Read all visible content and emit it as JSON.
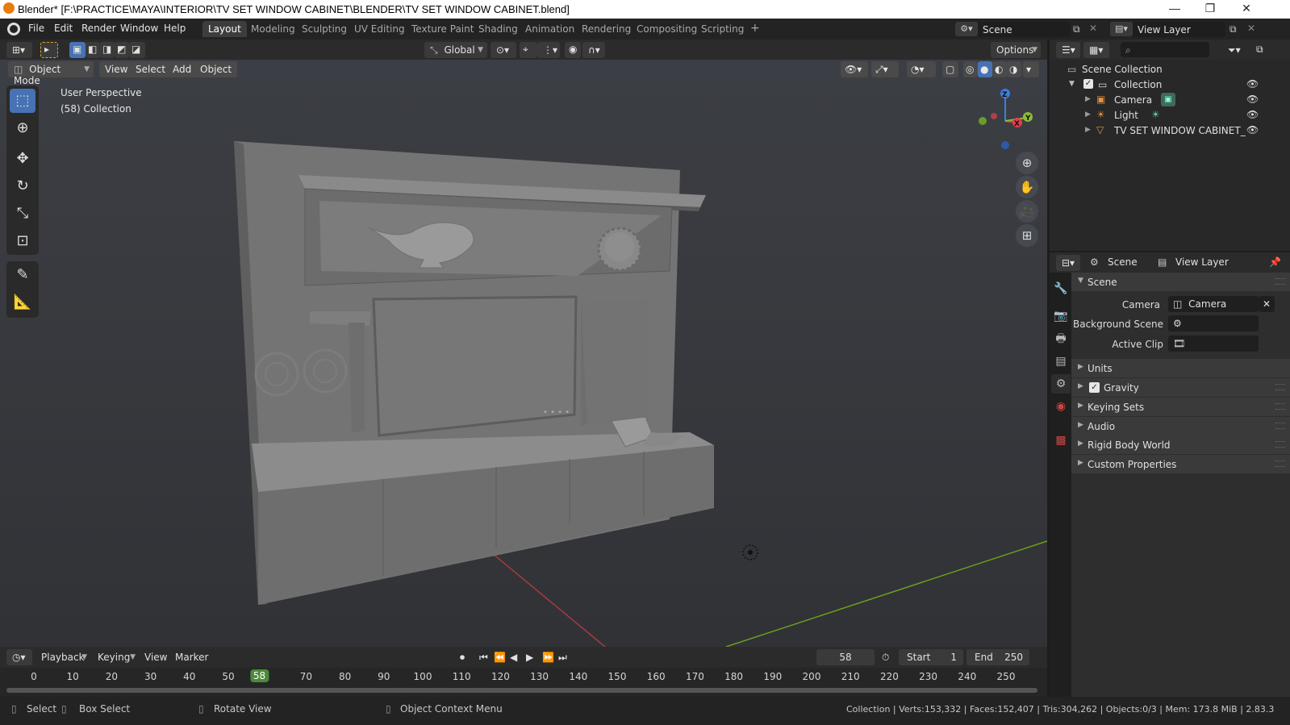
{
  "title_bar": {
    "title": "Blender* [F:\\PRACTICE\\MAYA\\INTERIOR\\TV SET WINDOW CABINET\\BLENDER\\TV SET WINDOW CABINET.blend]",
    "minimize": "—",
    "maximize": "❐",
    "close": "✕"
  },
  "menubar": {
    "menus": [
      "File",
      "Edit",
      "Render",
      "Window",
      "Help"
    ],
    "workspaces": [
      "Layout",
      "Modeling",
      "Sculpting",
      "UV Editing",
      "Texture Paint",
      "Shading",
      "Animation",
      "Rendering",
      "Compositing",
      "Scripting"
    ],
    "active_workspace": "Layout",
    "add_tab": "+",
    "scene": "Scene",
    "view_layer": "View Layer"
  },
  "tool_header": {
    "transform_orientation": "Global",
    "options": "Options"
  },
  "viewport": {
    "mode": "Object Mode",
    "menus": [
      "View",
      "Select",
      "Add",
      "Object"
    ],
    "info_line1": "User Perspective",
    "info_line2": "(58) Collection",
    "gizmo_axes": {
      "x": "X",
      "y": "Y",
      "z": "Z"
    },
    "colors": {
      "x": "#e0404d",
      "y": "#8fbc35",
      "z": "#3a7fe6"
    }
  },
  "outliner": {
    "root": "Scene Collection",
    "collection": "Collection",
    "items": [
      {
        "name": "Camera",
        "icon": "camera-icon"
      },
      {
        "name": "Light",
        "icon": "light-icon"
      },
      {
        "name": "TV SET WINDOW CABINET_",
        "icon": "mesh-icon"
      }
    ]
  },
  "properties": {
    "header_scene": "Scene",
    "header_view_layer": "View Layer",
    "section": "Scene",
    "camera_label": "Camera",
    "camera_value": "Camera",
    "background_scene_label": "Background Scene",
    "active_clip_label": "Active Clip",
    "panels": [
      "Units",
      "Gravity",
      "Keying Sets",
      "Audio",
      "Rigid Body World",
      "Custom Properties"
    ],
    "gravity_checked": true
  },
  "timeline": {
    "menus": [
      "Playback",
      "Keying",
      "View",
      "Marker"
    ],
    "current_frame": "58",
    "start_label": "Start",
    "start": "1",
    "end_label": "End",
    "end": "250",
    "ruler": [
      "0",
      "10",
      "20",
      "30",
      "40",
      "50",
      "58",
      "70",
      "80",
      "90",
      "100",
      "110",
      "120",
      "130",
      "140",
      "150",
      "160",
      "170",
      "180",
      "190",
      "200",
      "210",
      "220",
      "230",
      "240",
      "250"
    ]
  },
  "status_bar": {
    "select": "Select",
    "box_select": "Box Select",
    "rotate_view": "Rotate View",
    "context_menu": "Object Context Menu",
    "stats": "Collection | Verts:153,332 | Faces:152,407 | Tris:304,262 | Objects:0/3 | Mem: 173.8 MiB | 2.83.3"
  }
}
